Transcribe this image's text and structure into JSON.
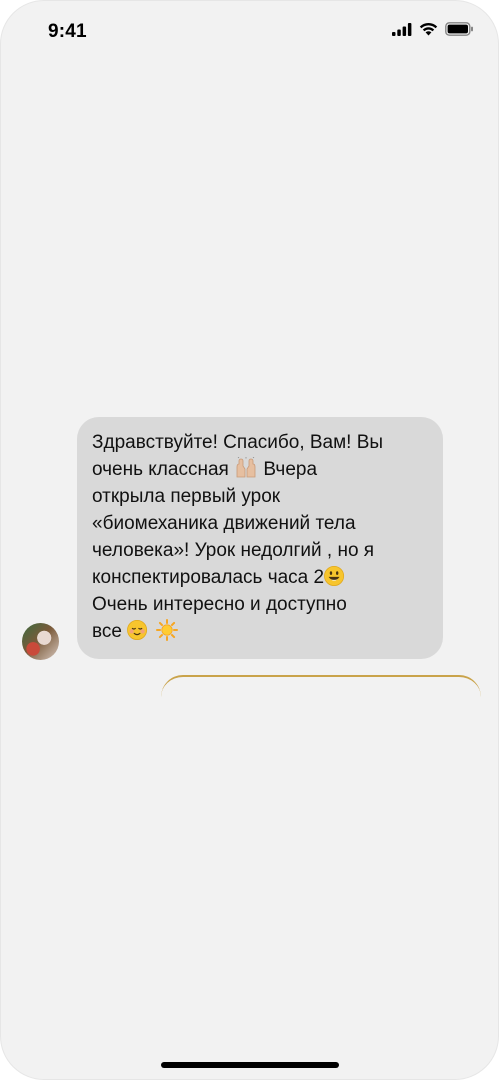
{
  "status_bar": {
    "time": "9:41",
    "icons": [
      "cellular-signal-icon",
      "wifi-icon",
      "battery-icon"
    ]
  },
  "chat": {
    "message": {
      "lines": [
        "Здравствуйте! Спасибо, Вам! Вы",
        "очень классная",
        "Вчера",
        "открыла первый урок",
        "«биомеханика движений тела",
        "человека»! Урок недолгий , но я",
        "конспектировалась часа 2",
        "Очень интересно и доступно",
        "все"
      ],
      "emojis": [
        "raised-hands-emoji",
        "smiley-emoji",
        "relieved-smile-emoji",
        "sun-emoji"
      ]
    },
    "avatar": "user-avatar"
  },
  "colors": {
    "background": "#f2f2f2",
    "bubble": "#d9d9d9",
    "accent_edge": "#c9a34a"
  }
}
